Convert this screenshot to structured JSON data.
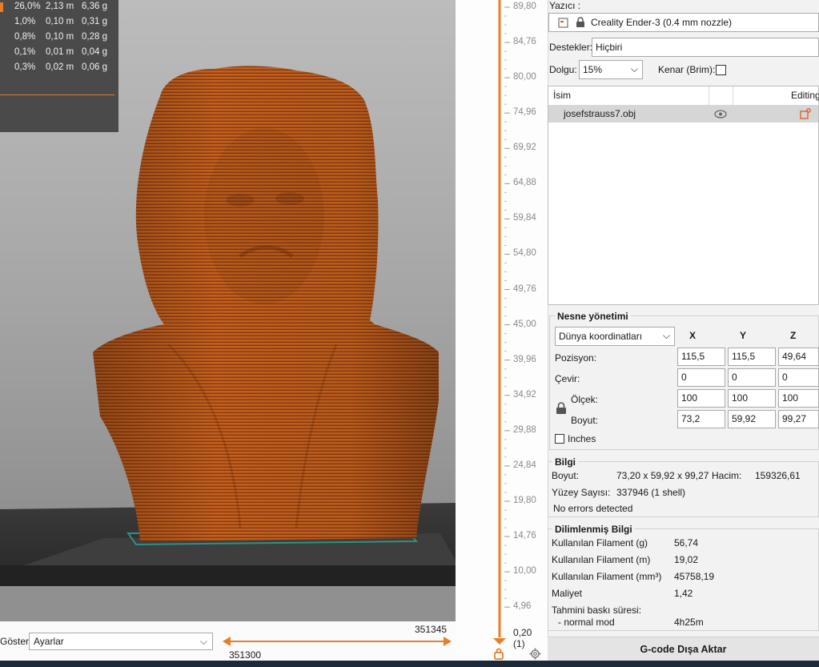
{
  "legend": {
    "rows": [
      {
        "percent": "26,0%",
        "length": "2,13 m",
        "weight": "6,36 g"
      },
      {
        "percent": "1,0%",
        "length": "0,10 m",
        "weight": "0,31 g"
      },
      {
        "percent": "0,8%",
        "length": "0,10 m",
        "weight": "0,28 g"
      },
      {
        "percent": "0,1%",
        "length": "0,01 m",
        "weight": "0,04 g"
      },
      {
        "percent": "0,3%",
        "length": "0,02 m",
        "weight": "0,06 g"
      }
    ]
  },
  "colors": {
    "accent": "#e57f2a",
    "model": "#b3531a",
    "legend_bg": "#4a4a4a"
  },
  "bottom_bar": {
    "show_label": "Göster",
    "show_select_value": "Ayarlar",
    "slider_min_value": "351300",
    "slider_max_value": "351345"
  },
  "vertical_slider": {
    "ticks": [
      "89,80",
      "84,76",
      "80,00",
      "74,96",
      "69,92",
      "64,88",
      "59,84",
      "54,80",
      "49,76",
      "45,00",
      "39,96",
      "34,92",
      "29,88",
      "24,84",
      "19,80",
      "14,76",
      "10,00",
      "4,96"
    ],
    "bottom_value": "0,20",
    "bottom_layer": "(1)",
    "icons": [
      "lock-icon",
      "settings-icon"
    ]
  },
  "panel": {
    "printer_label": "Yazıcı :",
    "printer_value": "Creality Ender-3 (0.4 mm nozzle)",
    "supports_label": "Destekler:",
    "supports_value": "Hiçbiri",
    "infill_label": "Dolgu:",
    "infill_value": "15%",
    "brim_label": "Kenar (Brim):",
    "object_list": {
      "col_name": "İsim",
      "col_editing": "Editing",
      "items": [
        {
          "name": "josefstrauss7.obj"
        }
      ]
    },
    "object_manip": {
      "title": "Nesne yönetimi",
      "coord_select": "Dünya koordinatları",
      "axes": [
        "X",
        "Y",
        "Z"
      ],
      "rows": [
        {
          "label": "Pozisyon:",
          "values": [
            "115,5",
            "115,5",
            "49,64"
          ]
        },
        {
          "label": "Çevir:",
          "values": [
            "0",
            "0",
            "0"
          ]
        },
        {
          "label": "Ölçek:",
          "values": [
            "100",
            "100",
            "100"
          ]
        },
        {
          "label": "Boyut:",
          "values": [
            "73,2",
            "59,92",
            "99,27"
          ]
        }
      ],
      "inches_label": "Inches"
    },
    "info": {
      "title": "Bilgi",
      "size_label": "Boyut:",
      "size_value": "73,20 x 59,92 x 99,27",
      "volume_label": "Hacim:",
      "volume_value": "159326,61",
      "facets_label": "Yüzey Sayısı:",
      "facets_value": "337946 (1 shell)",
      "errors": "No errors detected"
    },
    "sliced": {
      "title": "Dilimlenmiş Bilgi",
      "rows": [
        {
          "label": "Kullanılan Filament (g)",
          "value": "56,74"
        },
        {
          "label": "Kullanılan Filament (m)",
          "value": "19,02"
        },
        {
          "label": "Kullanılan Filament (mm³)",
          "value": "45758,19"
        },
        {
          "label": "Maliyet",
          "value": "1,42"
        }
      ],
      "time_label": "Tahmini baskı süresi:",
      "mode_label": "- normal mod",
      "mode_value": "4h25m"
    },
    "export_label": "G-code Dışa Aktar"
  }
}
